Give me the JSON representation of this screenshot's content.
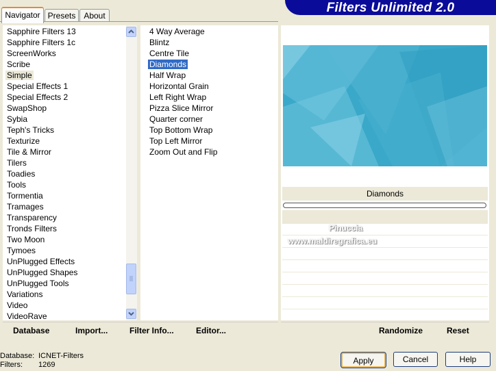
{
  "tabs": [
    {
      "label": "Navigator"
    },
    {
      "label": "Presets"
    },
    {
      "label": "About"
    }
  ],
  "banner": {
    "title": "Filters Unlimited 2.0"
  },
  "categories": {
    "items": [
      "Sapphire Filters 13",
      "Sapphire Filters 1c",
      "ScreenWorks",
      "Scribe",
      "Simple",
      "Special Effects 1",
      "Special Effects 2",
      "SwapShop",
      "Sybia",
      "Teph's Tricks",
      "Texturize",
      "Tile & Mirror",
      "Tilers",
      "Toadies",
      "Tools",
      "Tormentia",
      "Tramages",
      "Transparency",
      "Tronds Filters",
      "Two Moon",
      "Tymoes",
      "UnPlugged Effects",
      "UnPlugged Shapes",
      "UnPlugged Tools",
      "Variations",
      "Video",
      "VideoRave"
    ],
    "selected": "Simple"
  },
  "filters": {
    "items": [
      "4 Way Average",
      "Blintz",
      "Centre Tile",
      "Diamonds",
      "Half Wrap",
      "Horizontal Grain",
      "Left Right Wrap",
      "Pizza Slice Mirror",
      "Quarter corner",
      "Top Bottom Wrap",
      "Top Left Mirror",
      "Zoom Out and Flip"
    ],
    "selected": "Diamonds"
  },
  "preview": {
    "filter_name": "Diamonds",
    "watermark_line1": "Pinuccia",
    "watermark_line2": "www.maldiregrafica.eu"
  },
  "left_actions": {
    "database": "Database",
    "import": "Import...",
    "filter_info": "Filter Info...",
    "editor": "Editor..."
  },
  "right_actions": {
    "randomize": "Randomize",
    "reset": "Reset"
  },
  "status": {
    "database_label": "Database:",
    "database_value": "ICNET-Filters",
    "filters_label": "Filters:",
    "filters_value": "1269"
  },
  "buttons": {
    "apply": "Apply",
    "cancel": "Cancel",
    "help": "Help"
  },
  "colors": {
    "selection": "#316ac5",
    "banner": "#0b0b9a",
    "preview": "#3aa8c9"
  }
}
